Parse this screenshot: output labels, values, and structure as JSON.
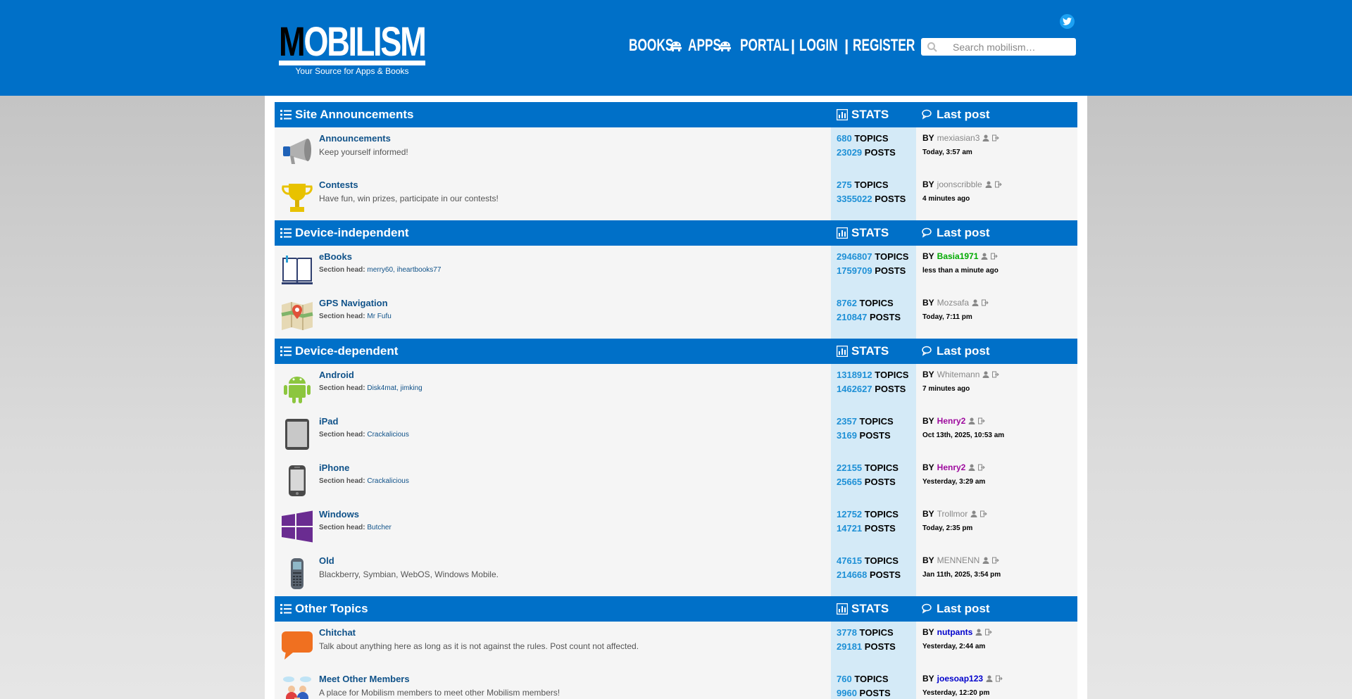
{
  "header": {
    "logo_letter": "M",
    "logo_rest": "OBILISM",
    "tagline": "Your Source for Apps & Books",
    "nav": {
      "books": "BOOKS",
      "apps": "APPS",
      "portal": "PORTAL",
      "login": "LOGIN",
      "register": "REGISTER",
      "separator": "|"
    },
    "search_placeholder": "Search mobilism…"
  },
  "labels": {
    "stats": "STATS",
    "last_post": "Last post",
    "topics": "TOPICS",
    "posts": "POSTS",
    "by": "BY",
    "section_head": "Section head:"
  },
  "sections": [
    {
      "title": "Site Announcements",
      "forums": [
        {
          "name": "Announcements",
          "desc": "Keep yourself informed!",
          "icon": "megaphone-icon",
          "topics": "680",
          "posts": "23029",
          "last_user": "mexiasian3",
          "last_time": "Today, 3:57 am"
        },
        {
          "name": "Contests",
          "desc": "Have fun, win prizes, participate in our contests!",
          "icon": "trophy-icon",
          "topics": "275",
          "posts": "3355022",
          "last_user": "joonscribble",
          "last_time": "4 minutes ago"
        }
      ]
    },
    {
      "title": "Device-independent",
      "forums": [
        {
          "name": "eBooks",
          "heads": "merry60, iheartbooks77",
          "icon": "book-icon",
          "topics": "2946807",
          "posts": "1759709",
          "last_user": "Basia1971",
          "last_time": "less than a minute ago"
        },
        {
          "name": "GPS Navigation",
          "heads": "Mr Fufu",
          "icon": "map-icon",
          "topics": "8762",
          "posts": "210847",
          "last_user": "Mozsafa",
          "last_time": "Today, 7:11 pm"
        }
      ]
    },
    {
      "title": "Device-dependent",
      "forums": [
        {
          "name": "Android",
          "heads": "Disk4mat, jimking",
          "icon": "android-icon",
          "topics": "1318912",
          "posts": "1462627",
          "last_user": "Whitemann",
          "last_time": "7 minutes ago"
        },
        {
          "name": "iPad",
          "heads": "Crackalicious",
          "icon": "ipad-icon",
          "topics": "2357",
          "posts": "3169",
          "last_user": "Henry2",
          "last_time": "Oct 13th, 2025, 10:53 am"
        },
        {
          "name": "iPhone",
          "heads": "Crackalicious",
          "icon": "iphone-icon",
          "topics": "22155",
          "posts": "25665",
          "last_user": "Henry2",
          "last_time": "Yesterday, 3:29 am"
        },
        {
          "name": "Windows",
          "heads": "Butcher",
          "icon": "windows-icon",
          "topics": "12752",
          "posts": "14721",
          "last_user": "Trollmor",
          "last_time": "Today, 2:35 pm"
        },
        {
          "name": "Old",
          "desc": "Blackberry, Symbian, WebOS, Windows Mobile.",
          "icon": "old-phone-icon",
          "topics": "47615",
          "posts": "214668",
          "last_user": "MENNENN",
          "last_time": "Jan 11th, 2025, 3:54 pm"
        }
      ]
    },
    {
      "title": "Other Topics",
      "forums": [
        {
          "name": "Chitchat",
          "desc": "Talk about anything here as long as it is not against the rules. Post count not affected.",
          "icon": "chat-bubble-icon",
          "topics": "3778",
          "posts": "29181",
          "last_user": "nutpants",
          "last_time": "Yesterday, 2:44 am"
        },
        {
          "name": "Meet Other Members",
          "desc": "A place for Mobilism members to meet other Mobilism members!",
          "icon": "members-icon",
          "topics": "760",
          "posts": "9960",
          "last_user": "joesoap123",
          "last_time": "Yesterday, 12:20 pm"
        }
      ]
    }
  ],
  "colors": {
    "header_blue": "#0070c8",
    "link": "#105289",
    "stat_number": "#1e90d6",
    "stats_bg": "#d4eaf7",
    "user_green": "#00aa00",
    "user_purple": "#9e0a9e",
    "user_blue": "#0000cc",
    "twitter": "#1da1f2"
  }
}
